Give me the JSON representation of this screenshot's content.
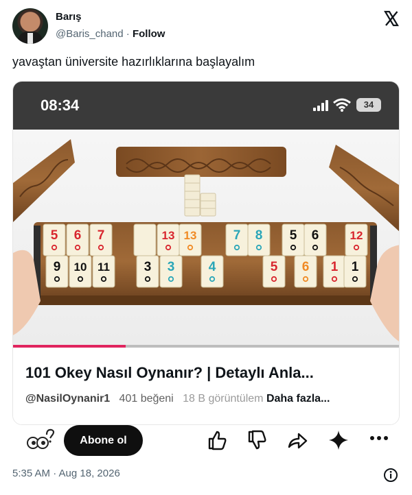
{
  "author": {
    "name": "Barış",
    "handle": "@Baris_chand",
    "separator": "·",
    "follow_label": "Follow"
  },
  "tweet": {
    "text": "yavaştan üniversite hazırlıklarına başlayalım",
    "timestamp": "5:35 AM · Aug 18, 2026"
  },
  "phone_status": {
    "time": "08:34",
    "battery": "34"
  },
  "video": {
    "title": "101 Okey Nasıl Oynanır? | Detaylı Anla...",
    "channel": "@NasilOynanir1",
    "likes": "401 beğeni",
    "views": "18 B görüntülem",
    "more_label": "Daha fazla...",
    "subscribe_label": "Abone ol",
    "progress": 0.29
  },
  "rack_tiles": {
    "top_row": [
      {
        "n": "5",
        "c": "#d8262e"
      },
      {
        "n": "6",
        "c": "#d8262e"
      },
      {
        "n": "7",
        "c": "#d8262e"
      },
      {
        "n": "",
        "c": "#d8262e"
      },
      {
        "n": "13",
        "c": "#d8262e"
      },
      {
        "n": "13",
        "c": "#f08a24"
      },
      {
        "n": "7",
        "c": "#2aa6b8"
      },
      {
        "n": "8",
        "c": "#2aa6b8"
      },
      {
        "n": "5",
        "c": "#111111"
      },
      {
        "n": "6",
        "c": "#111111"
      },
      {
        "n": "12",
        "c": "#d8262e"
      }
    ],
    "bottom_row": [
      {
        "n": "9",
        "c": "#111111"
      },
      {
        "n": "10",
        "c": "#111111"
      },
      {
        "n": "11",
        "c": "#111111"
      },
      {
        "n": "3",
        "c": "#111111"
      },
      {
        "n": "3",
        "c": "#2aa6b8"
      },
      {
        "n": "4",
        "c": "#2aa6b8"
      },
      {
        "n": "5",
        "c": "#d8262e"
      },
      {
        "n": "6",
        "c": "#f08a24"
      },
      {
        "n": "1",
        "c": "#d8262e"
      },
      {
        "n": "1",
        "c": "#111111"
      }
    ]
  },
  "icons": [
    "x-logo-icon",
    "signal-icon",
    "wifi-icon",
    "battery-icon",
    "emoji-icon",
    "like-icon",
    "dislike-icon",
    "share-icon",
    "sparkle-icon",
    "more-icon",
    "info-icon"
  ]
}
